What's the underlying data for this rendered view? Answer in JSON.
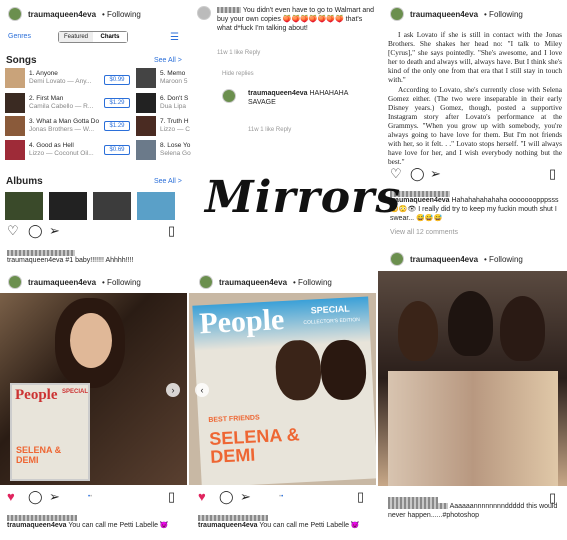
{
  "username": "traumaqueen4eva",
  "following": "• Following",
  "itunes": {
    "genres": "Genres",
    "tab_featured": "Featured",
    "tab_charts": "Charts",
    "songs_title": "Songs",
    "see_all": "See All >",
    "albums_title": "Albums",
    "songs": [
      {
        "title": "1. Anyone",
        "artist": "Demi Lovato — Any...",
        "price": "$0.99"
      },
      {
        "title": "2. First Man",
        "artist": "Camila Cabello — R...",
        "price": "$1.29"
      },
      {
        "title": "3. What a Man Gotta Do",
        "artist": "Jonas Brothers — W...",
        "price": "$1.29"
      },
      {
        "title": "4. Good as Hell",
        "artist": "Lizzo — Coconut Oil...",
        "price": "$0.69"
      }
    ],
    "songs2": [
      {
        "title": "5. Memo",
        "artist": "Maroon 5"
      },
      {
        "title": "6. Don't S",
        "artist": "Dua Lipa"
      },
      {
        "title": "7. Truth H",
        "artist": "Lizzo — C"
      },
      {
        "title": "8. Lose Yo",
        "artist": "Selena Go"
      }
    ]
  },
  "comments": {
    "c1": "You didn't even have to go to Walmart and buy your own copies 🍑🍑🍑🍑🍑🍑🍑 that's what d*fuck I'm talking about!",
    "c1_meta": "11w  1 like  Reply",
    "hide": "Hide replies",
    "c2": "HAHAHAHA SAVAGE",
    "c2_meta": "11w  1 like  Reply"
  },
  "article": {
    "p1": "I ask Lovato if she is still in contact with the Jonas Brothers. She shakes her head no: \"I talk to Miley [Cyrus],\" she says pointedly. \"She's awesome, and I love her to death and always will, always have. But I think she's kind of the only one from that era that I still stay in touch with.\"",
    "p2": "According to Lovato, she's currently close with Selena Gomez either. (The two were inseparable in their early Disney years.) Gomez, though, posted a supportive Instagram story after Lovato's performance at the Grammys. \"When you grow up with somebody, you're always going to have love for them. But I'm not friends with her, so it felt. . .\" Lovato stops herself. \"I will always have love for her, and I wish everybody nothing but the best.\""
  },
  "title": "Mirrors",
  "captions": {
    "tr_comment": "Hahahahahahaha ooooooopppsss 😳😳👁 I really did try to keep my fuckin mouth shut I swear... 😅😅😅",
    "view_all": "View all 12 comments",
    "ml": "traumaqueen4eva #1 baby!!!!!!! Ahhhh!!!!",
    "bl": "You can call me Petti Labelle 😈",
    "bm": "You can call me Petti Labelle 😈",
    "br": "Aaaaaannnnnnnnddddd this would never happen......#photoshop"
  },
  "magazine": {
    "brand": "People",
    "special": "SPECIAL",
    "edition": "COLLECTOR'S EDITION",
    "cover": "SELENA & DEMI",
    "best": "BEST FRIENDS"
  }
}
